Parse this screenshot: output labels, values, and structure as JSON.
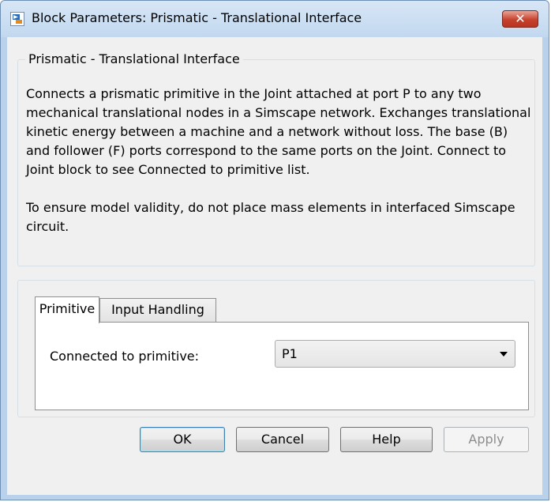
{
  "window": {
    "title": "Block Parameters: Prismatic - Translational Interface",
    "close_label": "✕"
  },
  "description": {
    "heading": "Prismatic - Translational Interface",
    "paragraph1": "Connects a prismatic primitive in the Joint attached at port P to any two mechanical translational nodes in a Simscape network. Exchanges translational kinetic energy between a machine and a network without loss. The base (B) and follower (F) ports correspond to the same ports on the Joint. Connect to Joint block to see Connected to primitive list.",
    "paragraph2": "To ensure model validity, do not place mass elements in interfaced Simscape circuit."
  },
  "tabs": [
    {
      "label": "Primitive",
      "selected": true
    },
    {
      "label": "Input Handling",
      "selected": false
    }
  ],
  "primitive_tab": {
    "field_label": "Connected to primitive:",
    "selected_value": "P1"
  },
  "buttons": {
    "ok": "OK",
    "cancel": "Cancel",
    "help": "Help",
    "apply": "Apply"
  }
}
